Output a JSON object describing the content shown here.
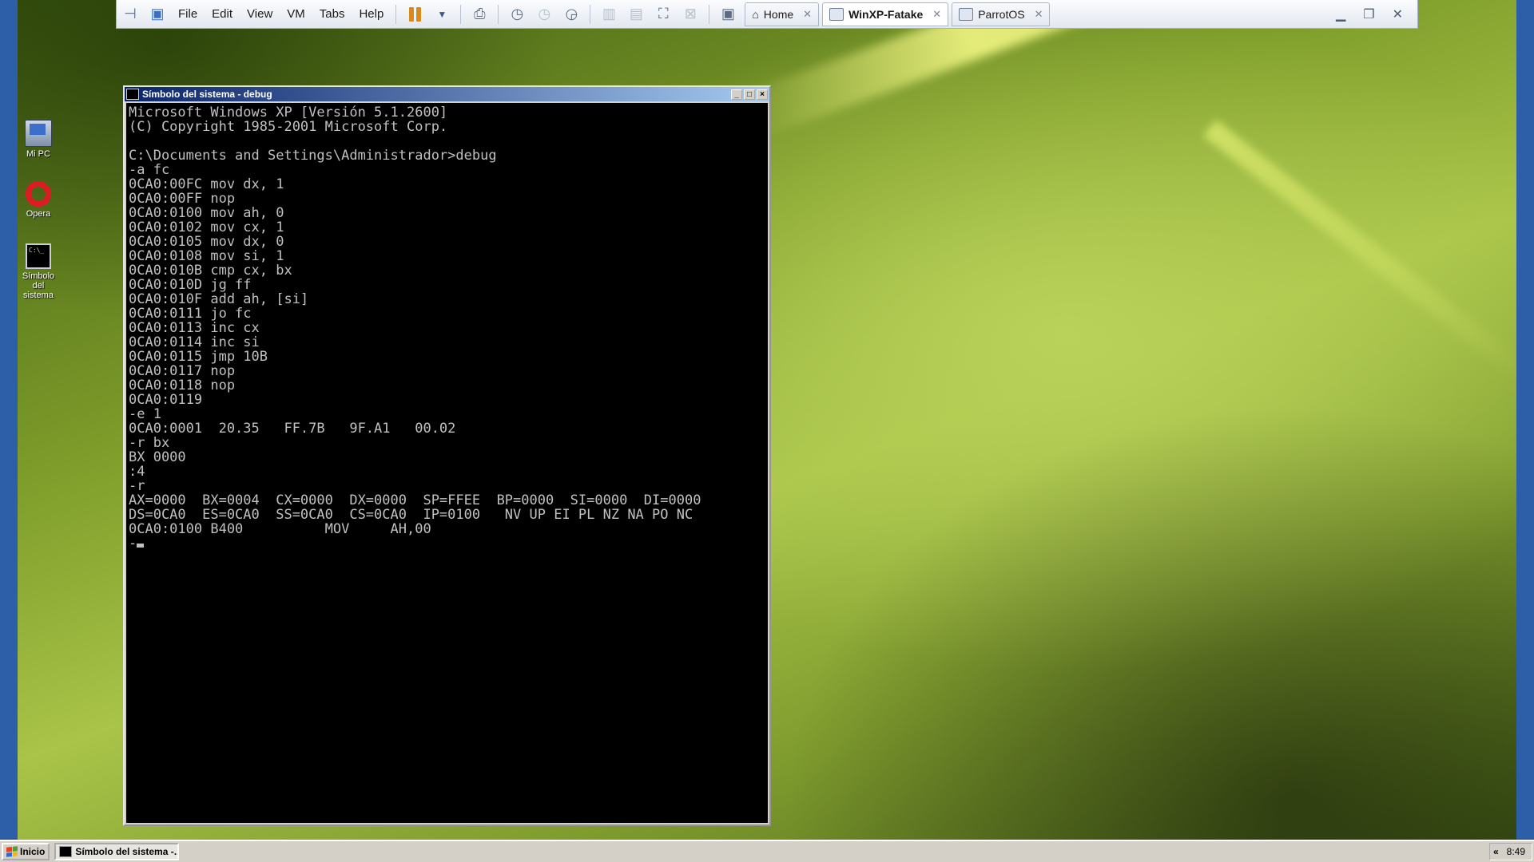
{
  "vmware": {
    "menus": [
      "File",
      "Edit",
      "View",
      "VM",
      "Tabs",
      "Help"
    ],
    "tabs": [
      {
        "label": "Home",
        "active": false
      },
      {
        "label": "WinXP-Fatake",
        "active": true
      },
      {
        "label": "ParrotOS",
        "active": false
      }
    ],
    "close_glyph": "✕"
  },
  "desktop_icons": {
    "mi_pc": "Mi PC",
    "opera": "Opera",
    "cmd": "Símbolo del sistema",
    "cmd_glyph_text": "C:\\_"
  },
  "console": {
    "title": "Símbolo del sistema - debug",
    "lines": [
      "Microsoft Windows XP [Versión 5.1.2600]",
      "(C) Copyright 1985-2001 Microsoft Corp.",
      "",
      "C:\\Documents and Settings\\Administrador>debug",
      "-a fc",
      "0CA0:00FC mov dx, 1",
      "0CA0:00FF nop",
      "0CA0:0100 mov ah, 0",
      "0CA0:0102 mov cx, 1",
      "0CA0:0105 mov dx, 0",
      "0CA0:0108 mov si, 1",
      "0CA0:010B cmp cx, bx",
      "0CA0:010D jg ff",
      "0CA0:010F add ah, [si]",
      "0CA0:0111 jo fc",
      "0CA0:0113 inc cx",
      "0CA0:0114 inc si",
      "0CA0:0115 jmp 10B",
      "0CA0:0117 nop",
      "0CA0:0118 nop",
      "0CA0:0119",
      "-e 1",
      "0CA0:0001  20.35   FF.7B   9F.A1   00.02",
      "-r bx",
      "BX 0000",
      ":4",
      "-r",
      "AX=0000  BX=0004  CX=0000  DX=0000  SP=FFEE  BP=0000  SI=0000  DI=0000",
      "DS=0CA0  ES=0CA0  SS=0CA0  CS=0CA0  IP=0100   NV UP EI PL NZ NA PO NC",
      "0CA0:0100 B400          MOV     AH,00",
      "-"
    ]
  },
  "taskbar": {
    "start_label": "Inicio",
    "task_label": "Símbolo del sistema -...",
    "tray_arrow": "«",
    "clock": "8:49"
  }
}
